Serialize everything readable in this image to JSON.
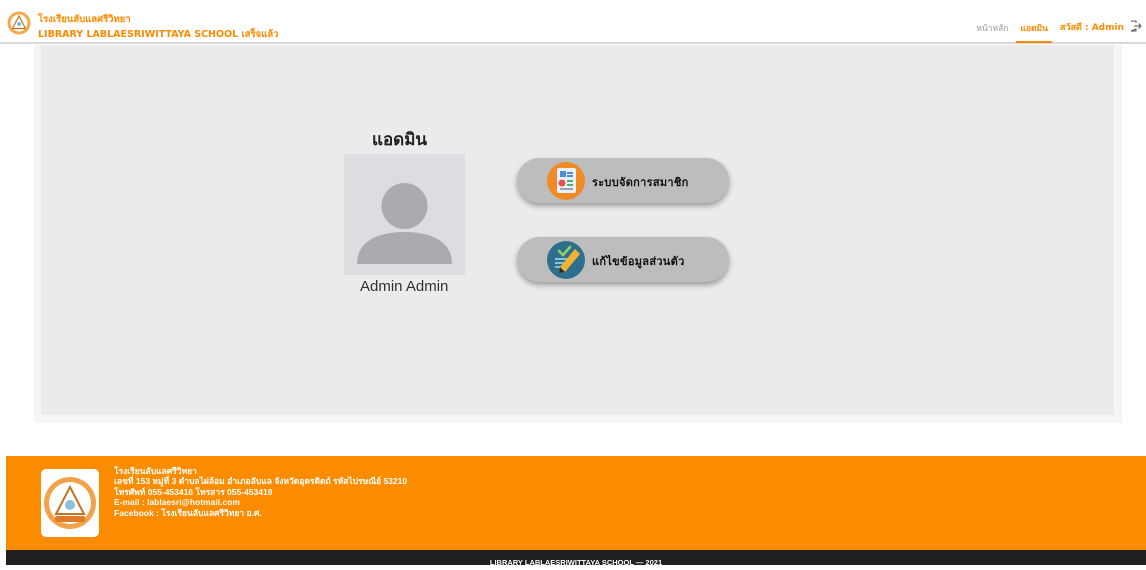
{
  "header": {
    "brand_th": "โรงเรียนลับแลศรีวิทยา",
    "brand_en": "LIBRARY LABLAESRIWITTAYA SCHOOL เสร็จแล้ว",
    "nav": {
      "home": "หน้าหลัก",
      "admin": "แอดมิน",
      "greeting": "สวัสดี : Admin"
    },
    "logout_icon": "logout-icon"
  },
  "main": {
    "title": "แอดมิน",
    "avatar_icon": "user-avatar-icon",
    "admin_name": "Admin Admin",
    "buttons": [
      {
        "label": "ระบบจัดการสมาชิก",
        "icon": "member-management-icon"
      },
      {
        "label": "แก้ไขข้อมูลส่วนตัว",
        "icon": "edit-profile-icon"
      }
    ]
  },
  "footer": {
    "lines": [
      "โรงเรียนลับแลศรีวิทยา",
      "เลขที่ 153 หมู่ที่ 3 ตำบลไผ่ล้อม อำเภอลับแล จังหวัดอุตรดิตถ์ รหัสไปรษณีย์ 53210",
      "โทรศัพท์ 055-453416 โทรสาร 055-453419",
      "E-mail : lablaesri@hotmail.com",
      "Facebook : โรงเรียนลับแลศรีวิทยา อ.ศ."
    ],
    "copyright": "LIBRARY LABLAESRIWITTAYA SCHOOL — 2021"
  },
  "colors": {
    "accent": "#ff8a00",
    "footer": "#fb8c00",
    "bottom_bar": "#212121",
    "pill": "#bdbdbd"
  }
}
